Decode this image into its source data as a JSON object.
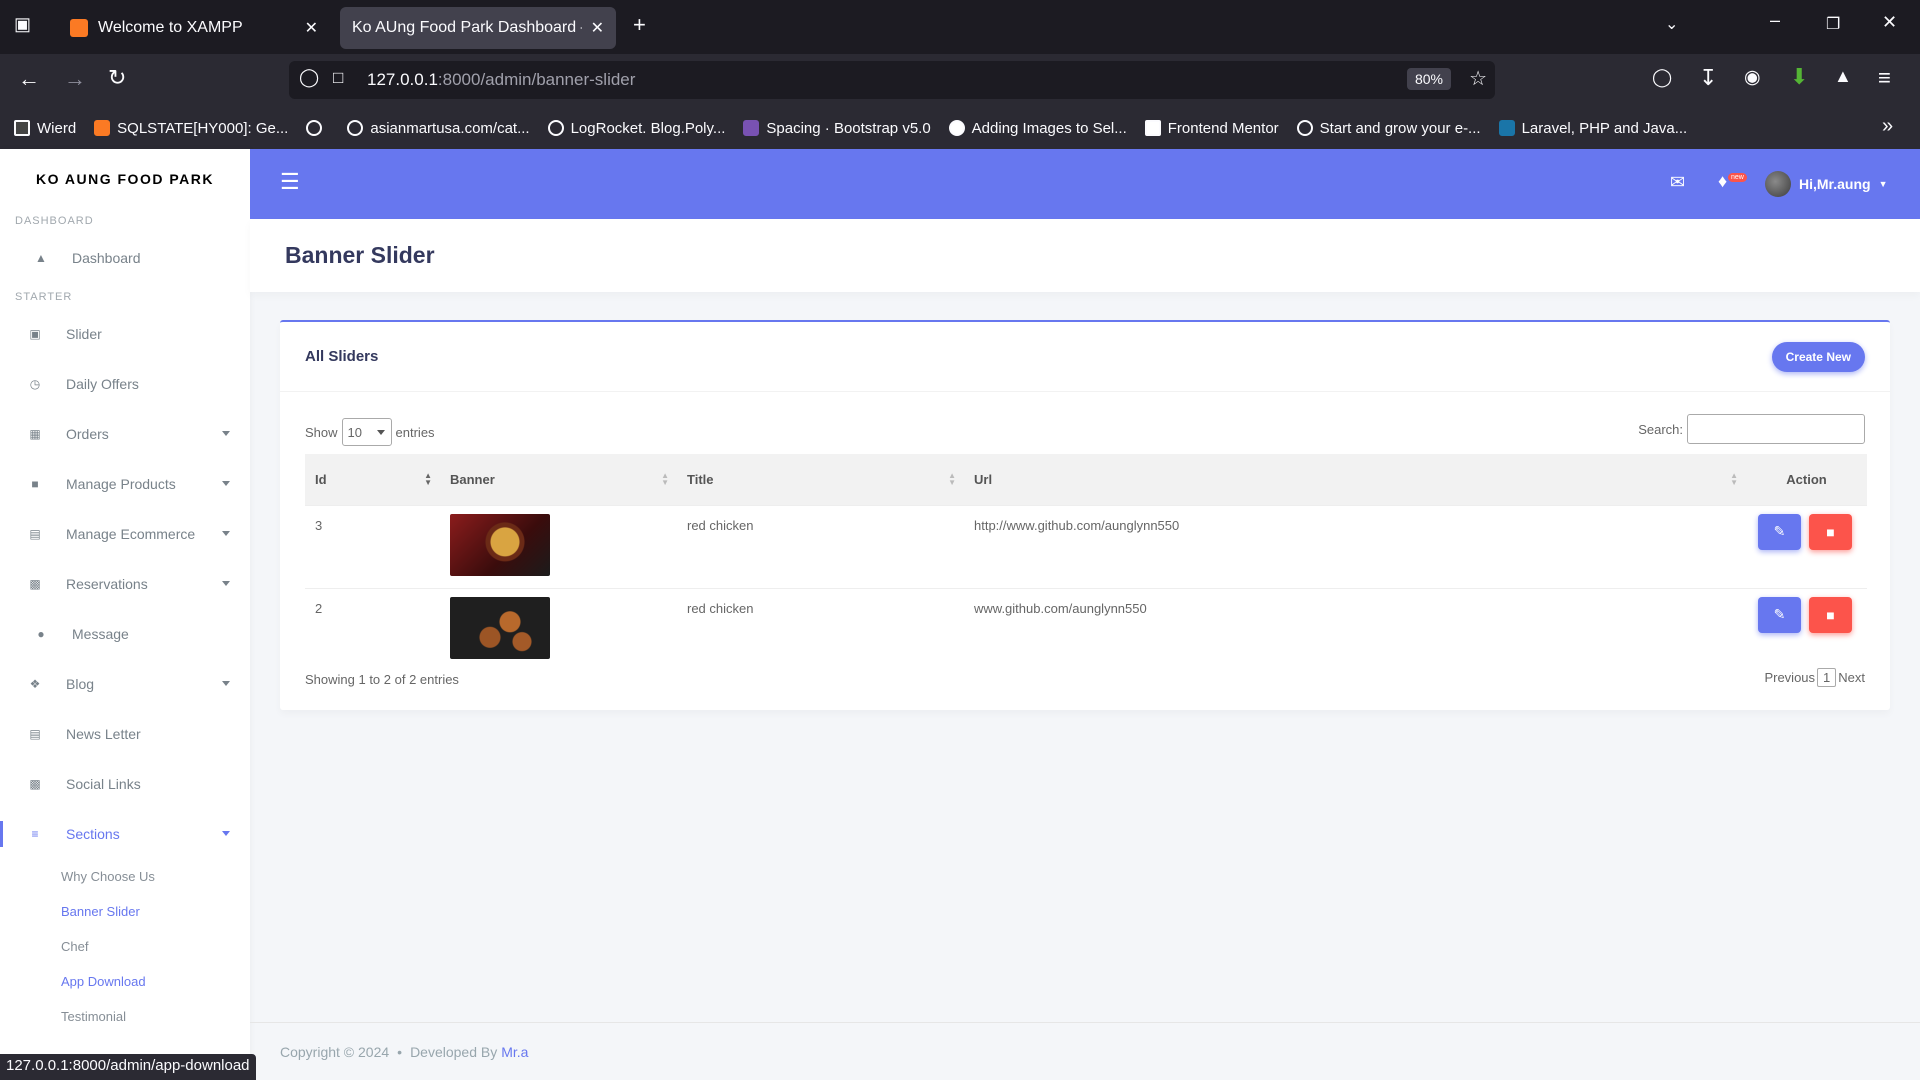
{
  "browser": {
    "tabs": [
      {
        "title": "Welcome to XAMPP"
      },
      {
        "title": "Ko AUng Food Park Dashboard — S"
      }
    ],
    "url_host": "127.0.0.1",
    "url_path": ":8000/admin/banner-slider",
    "zoom": "80%",
    "bookmarks": [
      "Wierd",
      "SQLSTATE[HY000]: Ge...",
      "asianmartusa.com/cat...",
      "LogRocket. Blog.Poly...",
      "Spacing · Bootstrap v5.0",
      "Adding Images to Sel...",
      "Frontend Mentor",
      "Start and grow your e-...",
      "Laravel, PHP and Java..."
    ],
    "status_url": "127.0.0.1:8000/admin/app-download"
  },
  "sidebar": {
    "brand": "KO AUNG FOOD PARK",
    "header_dashboard": "Dashboard",
    "header_starter": "Starter",
    "items": [
      {
        "label": "Dashboard",
        "icon": "fire-icon"
      },
      {
        "label": "Slider",
        "icon": "image-icon"
      },
      {
        "label": "Daily Offers",
        "icon": "clock-icon"
      },
      {
        "label": "Orders",
        "icon": "box-icon"
      },
      {
        "label": "Manage Products",
        "icon": "cart-icon"
      },
      {
        "label": "Manage Ecommerce",
        "icon": "store-icon"
      },
      {
        "label": "Reservations",
        "icon": "chair-icon"
      },
      {
        "label": "Message",
        "icon": "comment-icon"
      },
      {
        "label": "Blog",
        "icon": "blog-icon"
      },
      {
        "label": "News Letter",
        "icon": "newspaper-icon"
      },
      {
        "label": "Social Links",
        "icon": "link-icon"
      },
      {
        "label": "Sections",
        "icon": "bars-icon"
      }
    ],
    "subitems": [
      "Why Choose Us",
      "Banner Slider",
      "Chef",
      "App Download",
      "Testimonial"
    ]
  },
  "topnav": {
    "user_greeting": "Hi,Mr.aung",
    "notification_badge": "new"
  },
  "page": {
    "title": "Banner Slider",
    "card_title": "All Sliders",
    "create_button": "Create New",
    "show_label": "Show",
    "entries_value": "10",
    "entries_label": "entries",
    "search_label": "Search:",
    "columns": [
      "Id",
      "Banner",
      "Title",
      "Url",
      "Action"
    ],
    "rows": [
      {
        "id": "3",
        "title": "red chicken",
        "url": "http://www.github.com/aunglynn550"
      },
      {
        "id": "2",
        "title": "red chicken",
        "url": "www.github.com/aunglynn550"
      }
    ],
    "info": "Showing 1 to 2 of 2 entries",
    "previous": "Previous",
    "page_number": "1",
    "next": "Next"
  },
  "footer": {
    "copyright": "Copyright © 2024",
    "developed_by": "Developed By",
    "author": "Mr.a"
  }
}
